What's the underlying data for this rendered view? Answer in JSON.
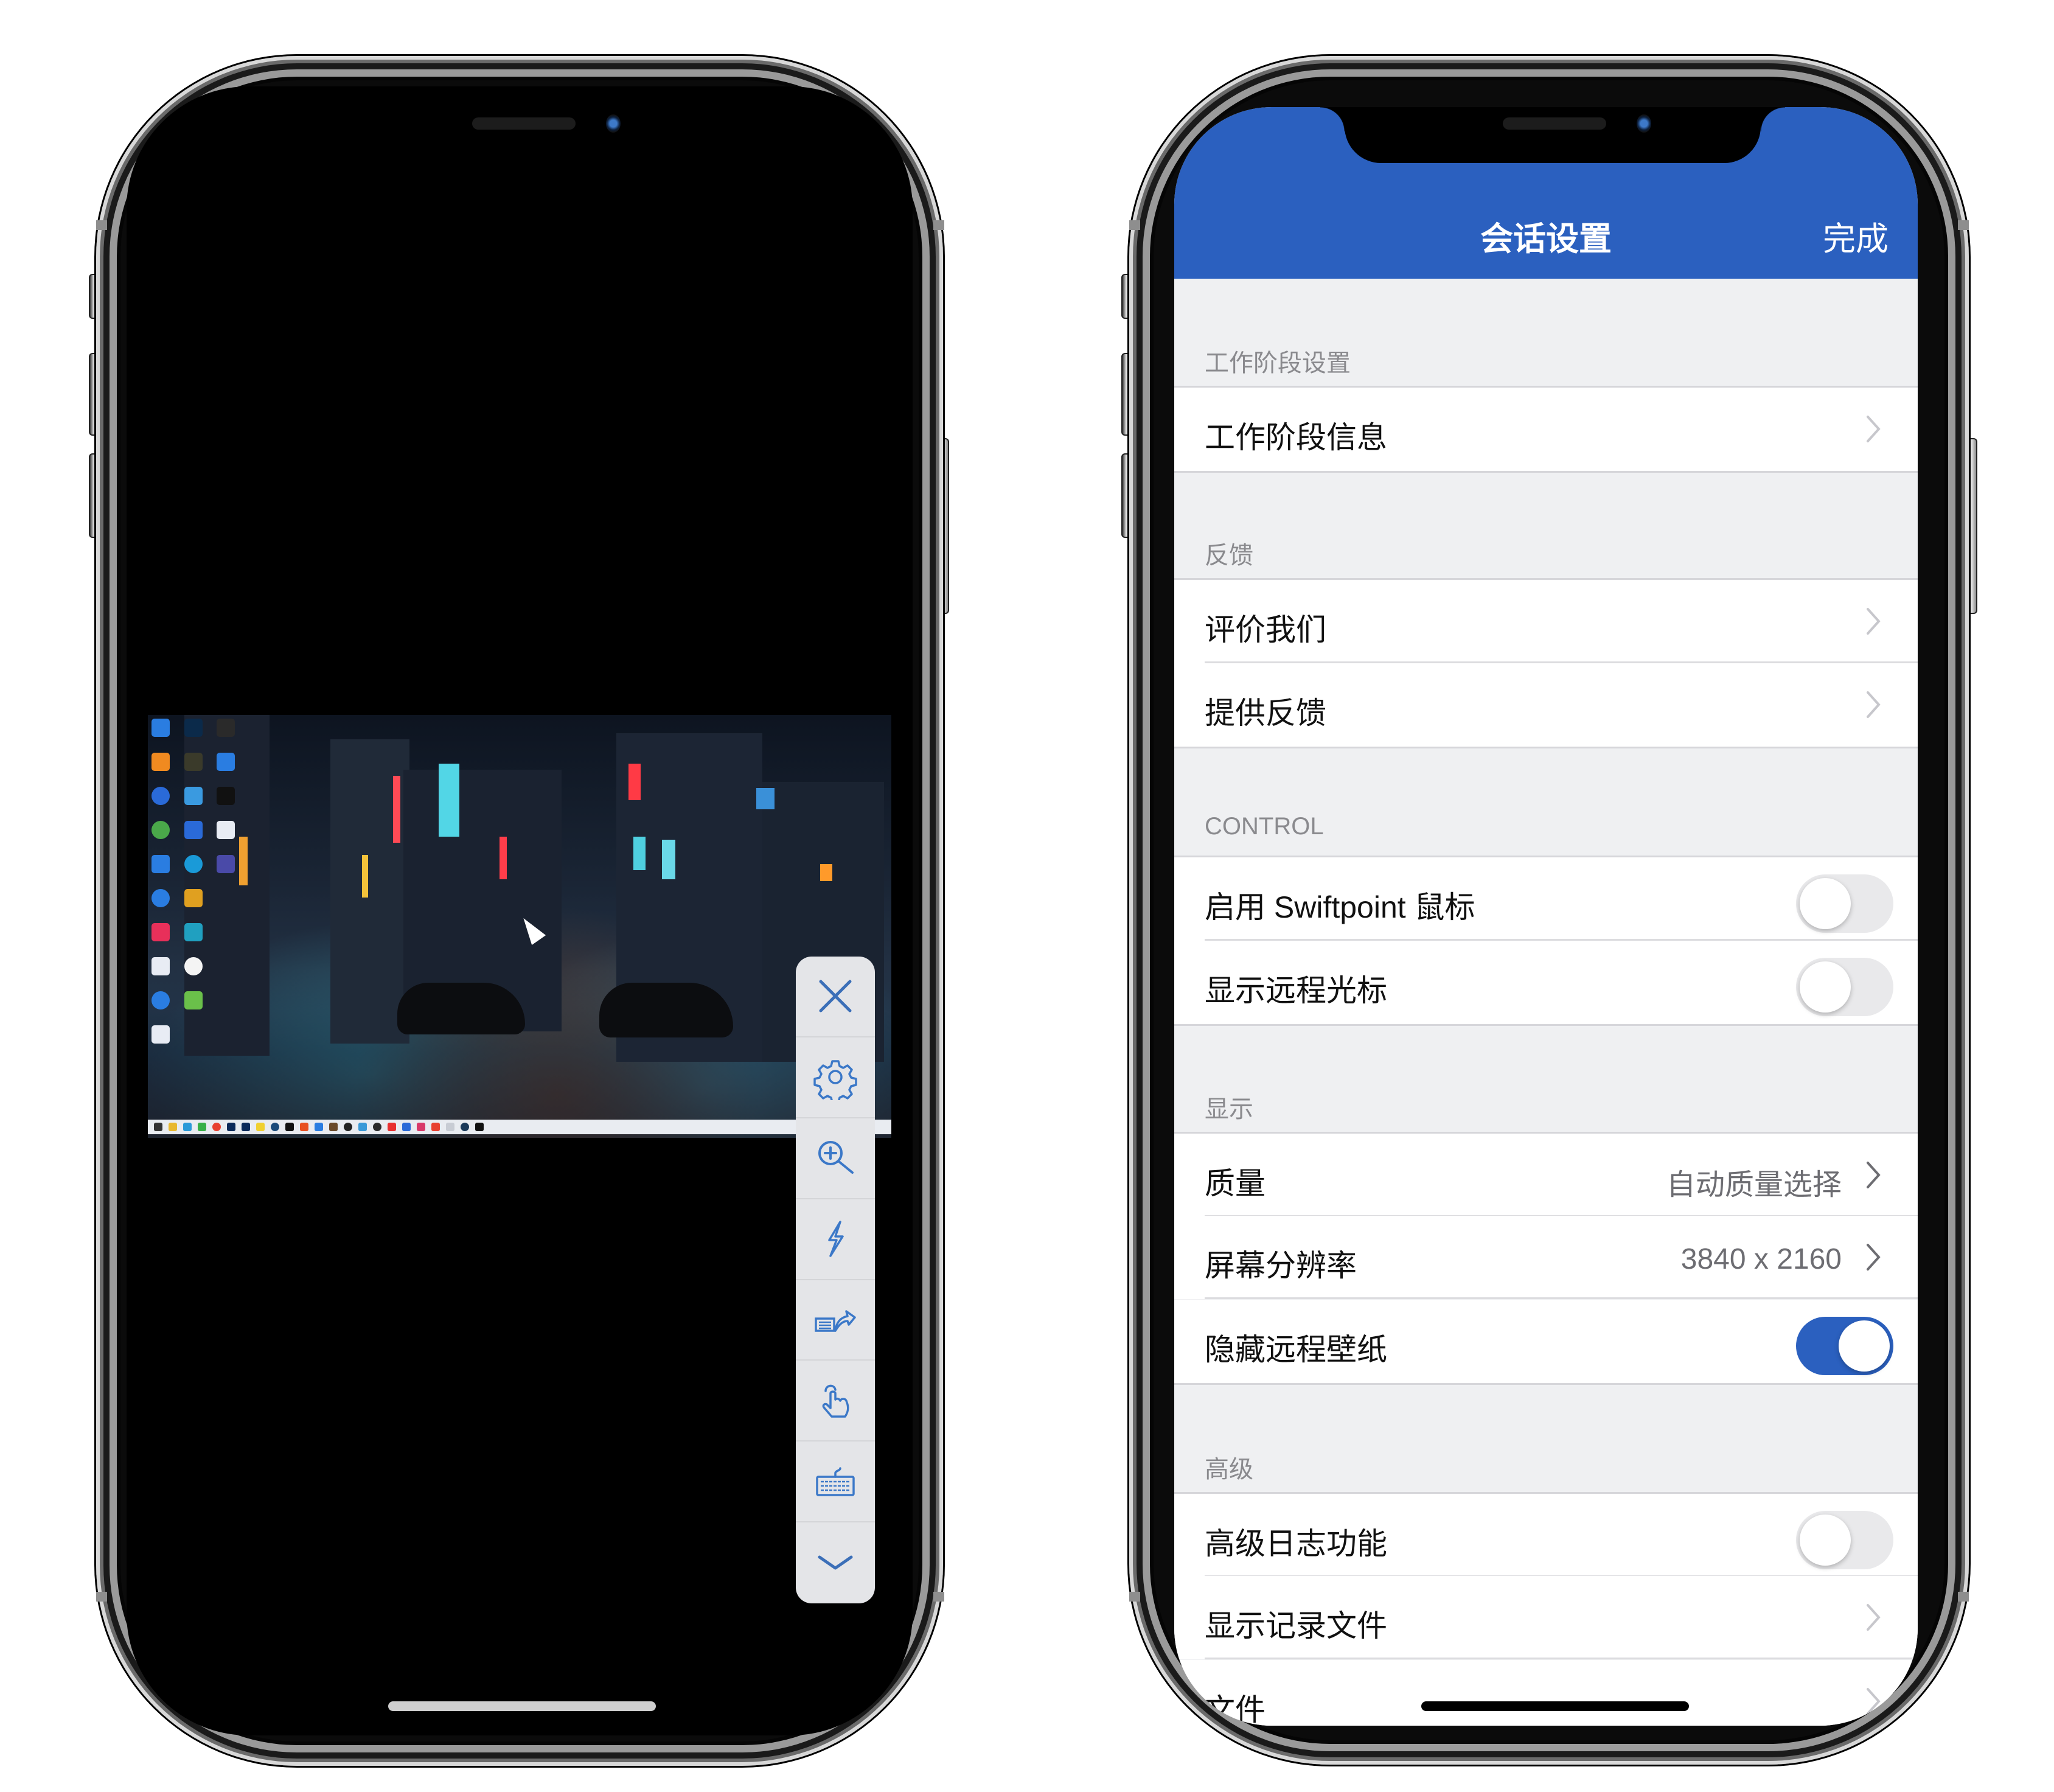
{
  "left_phone": {
    "app": "remote-desktop-session",
    "remote_desktop": {
      "description": "Windows desktop with neon rainy city wallpaper",
      "desktop_icon_count": 24,
      "taskbar_icon_count": 23
    },
    "toolbar": {
      "items": [
        {
          "icon": "close-icon",
          "action": "close"
        },
        {
          "icon": "gear-icon",
          "action": "settings"
        },
        {
          "icon": "zoom-in-icon",
          "action": "zoom"
        },
        {
          "icon": "lightning-icon",
          "action": "actions"
        },
        {
          "icon": "keyboard-arrow-icon",
          "action": "input-mode"
        },
        {
          "icon": "touch-pointer-icon",
          "action": "touch-mode"
        },
        {
          "icon": "keyboard-icon",
          "action": "keyboard"
        },
        {
          "icon": "chevron-down-icon",
          "action": "collapse"
        }
      ],
      "accent": "#3b78c8",
      "background": "#e4e5e8"
    }
  },
  "right_phone": {
    "header": {
      "title": "会话设置",
      "done_label": "完成",
      "color": "#2b60bf"
    },
    "sections": [
      {
        "title": "工作阶段设置",
        "rows": [
          {
            "label": "工作阶段信息",
            "type": "link"
          }
        ]
      },
      {
        "title": "反馈",
        "rows": [
          {
            "label": "评价我们",
            "type": "link"
          },
          {
            "label": "提供反馈",
            "type": "link"
          }
        ]
      },
      {
        "title": "CONTROL",
        "rows": [
          {
            "label": "启用 Swiftpoint 鼠标",
            "type": "toggle",
            "on": false
          },
          {
            "label": "显示远程光标",
            "type": "toggle",
            "on": false
          }
        ]
      },
      {
        "title": "显示",
        "rows": [
          {
            "label": "质量",
            "type": "link",
            "value": "自动质量选择"
          },
          {
            "label": "屏幕分辨率",
            "type": "link",
            "value": "3840 x 2160"
          },
          {
            "label": "隐藏远程壁纸",
            "type": "toggle",
            "on": true
          }
        ]
      },
      {
        "title": "高级",
        "rows": [
          {
            "label": "高级日志功能",
            "type": "toggle",
            "on": false
          },
          {
            "label": "显示记录文件",
            "type": "link"
          },
          {
            "label": "文件",
            "type": "link"
          }
        ]
      }
    ]
  }
}
